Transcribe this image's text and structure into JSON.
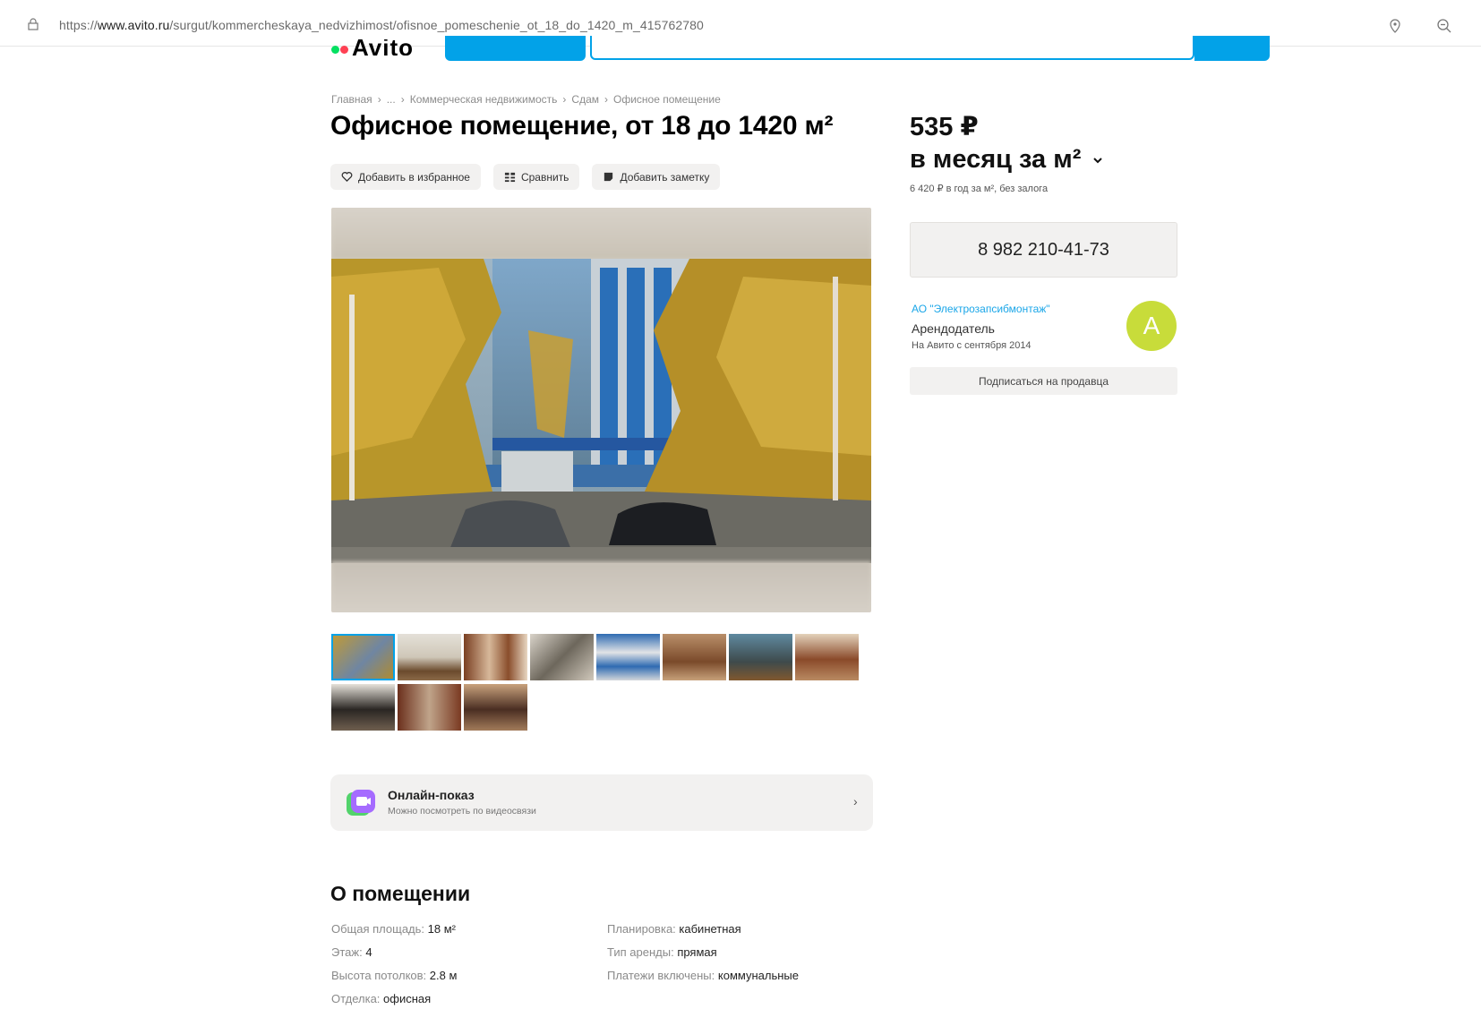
{
  "browser": {
    "url_prefix": "https://",
    "url_domain": "www.avito.ru",
    "url_path": "/surgut/kommercheskaya_nedvizhimost/ofisnoe_pomeschenie_ot_18_do_1420_m_415762780"
  },
  "header": {
    "logo_text": "Avito",
    "logo_dot_colors": [
      "#04e061",
      "#ff4053"
    ],
    "accent_color": "#02a2e8"
  },
  "breadcrumb": [
    "Главная",
    "...",
    "Коммерческая недвижимость",
    "Сдам",
    "Офисное помещение"
  ],
  "breadcrumb_separator": "›",
  "listing": {
    "title": "Офисное помещение, от 18 до 1420 м²",
    "actions": {
      "favorite": "Добавить в избранное",
      "compare": "Сравнить",
      "note": "Добавить заметку"
    }
  },
  "gallery": {
    "thumbnail_count": 11,
    "active_index": 0
  },
  "online_show": {
    "title": "Онлайн-показ",
    "subtitle": "Можно посмотреть по видеосвязи",
    "chevron": "›"
  },
  "about": {
    "title": "О помещении",
    "left": [
      {
        "label": "Общая площадь: ",
        "value": "18 м²"
      },
      {
        "label": "Этаж: ",
        "value": "4"
      },
      {
        "label": "Высота потолков: ",
        "value": "2.8 м"
      },
      {
        "label": "Отделка: ",
        "value": "офисная"
      }
    ],
    "right": [
      {
        "label": "Планировка: ",
        "value": "кабинетная"
      },
      {
        "label": "Тип аренды: ",
        "value": "прямая"
      },
      {
        "label": "Платежи включены: ",
        "value": "коммунальные"
      }
    ]
  },
  "price": {
    "amount": "535 ₽",
    "period": "в месяц за м²",
    "note": "6 420 ₽ в год за м², без залога"
  },
  "contact": {
    "phone": "8 982 210-41-73"
  },
  "seller": {
    "name": "АО \"Электрозапсибмонтаж\"",
    "role": "Арендодатель",
    "since": "На Авито с сентября 2014",
    "avatar_letter": "А",
    "avatar_color": "#c8dc3a",
    "subscribe": "Подписаться на продавца"
  }
}
